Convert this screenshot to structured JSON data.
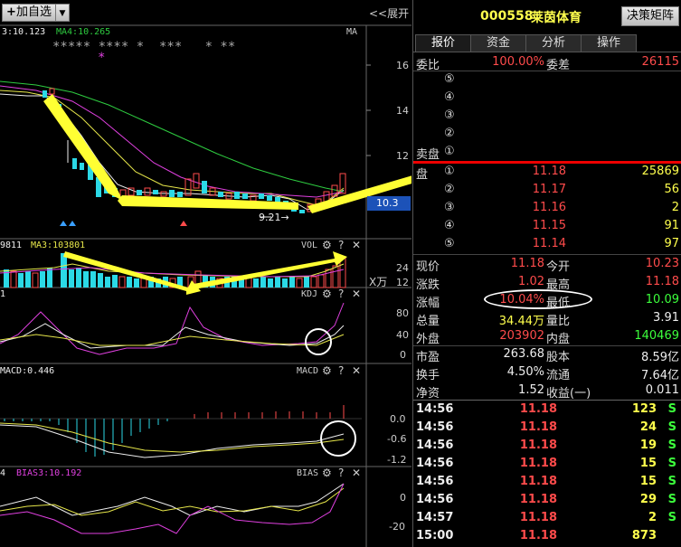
{
  "toolbar": {
    "add_watch_label": "加自选",
    "expand_label": "<<展开"
  },
  "chart": {
    "ma_header": {
      "left_text": "3:10.123",
      "ma4_label": "MA4:10.265",
      "ma_tag": "MA",
      "stars_line": "***** **** *  ***   * **",
      "star_magenta": "*"
    },
    "price_axis": [
      "16",
      "14",
      "12"
    ],
    "current_price_tag": "10.3",
    "low_annotation": "9.21→",
    "vol_header": {
      "left_text": "9811",
      "ma3_label": "MA3:103801",
      "name": "VOL"
    },
    "vol_axis": [
      "24",
      "12"
    ],
    "vol_unit": "X万",
    "kdj_header": {
      "left_text": "1",
      "name": "KDJ"
    },
    "kdj_axis": [
      "80",
      "40",
      "0"
    ],
    "macd_header": {
      "left_text": "MACD:0.446",
      "name": "MACD"
    },
    "macd_axis": [
      "0.0",
      "-0.6",
      "-1.2"
    ],
    "bias_header": {
      "left_text": "4",
      "bias3_label": "BIAS3:10.192",
      "name": "BIAS"
    },
    "bias_axis": [
      "0",
      "-20"
    ],
    "pane_icons": {
      "gear": "⚙",
      "help": "?",
      "close": "✕"
    }
  },
  "stock": {
    "code": "000558",
    "name": "莱茵体育",
    "decision_button": "决策矩阵"
  },
  "tabs": [
    {
      "label": "报价",
      "active": true
    },
    {
      "label": "资金",
      "active": false
    },
    {
      "label": "分析",
      "active": false
    },
    {
      "label": "操作",
      "active": false
    }
  ],
  "order_ratio": {
    "label1": "委比",
    "value1": "100.00%",
    "label2": "委差",
    "value2": "26115"
  },
  "sell_side": {
    "title": "卖盘",
    "levels": [
      "⑤",
      "④",
      "③",
      "②",
      "①"
    ]
  },
  "buy_side": {
    "title": "盘",
    "levels": [
      {
        "n": "①",
        "price": "11.18",
        "vol": "25869"
      },
      {
        "n": "②",
        "price": "11.17",
        "vol": "56"
      },
      {
        "n": "③",
        "price": "11.16",
        "vol": "2"
      },
      {
        "n": "④",
        "price": "11.15",
        "vol": "91"
      },
      {
        "n": "⑤",
        "price": "11.14",
        "vol": "97"
      }
    ]
  },
  "quote": {
    "rows": [
      {
        "l1": "现价",
        "v1": "11.18",
        "l2": "今开",
        "v2": "10.23"
      },
      {
        "l1": "涨跌",
        "v1": "1.02",
        "l2": "最高",
        "v2": "11.18"
      },
      {
        "l1": "涨幅",
        "v1": "10.04%",
        "l2": "最低",
        "v2": "10.09"
      },
      {
        "l1": "总量",
        "v1": "34.44万",
        "l2": "量比",
        "v2": "3.91"
      },
      {
        "l1": "外盘",
        "v1": "203902",
        "l2": "内盘",
        "v2": "140469"
      }
    ]
  },
  "fundamentals": {
    "rows": [
      {
        "l1": "市盈",
        "v1": "263.68",
        "l2": "股本",
        "v2": "8.59亿"
      },
      {
        "l1": "换手",
        "v1": "4.50%",
        "l2": "流通",
        "v2": "7.64亿"
      },
      {
        "l1": "净资",
        "v1": "1.52",
        "l2": "收益(一)",
        "v2": "0.011"
      }
    ]
  },
  "ticks": [
    {
      "time": "14:56",
      "price": "11.18",
      "vol": "123",
      "side": "S"
    },
    {
      "time": "14:56",
      "price": "11.18",
      "vol": "24",
      "side": "S"
    },
    {
      "time": "14:56",
      "price": "11.18",
      "vol": "19",
      "side": "S"
    },
    {
      "time": "14:56",
      "price": "11.18",
      "vol": "15",
      "side": "S"
    },
    {
      "time": "14:56",
      "price": "11.18",
      "vol": "15",
      "side": "S"
    },
    {
      "time": "14:56",
      "price": "11.18",
      "vol": "29",
      "side": "S"
    },
    {
      "time": "14:57",
      "price": "11.18",
      "vol": "2",
      "side": "S"
    },
    {
      "time": "15:00",
      "price": "11.18",
      "vol": "873",
      "side": ""
    }
  ]
}
